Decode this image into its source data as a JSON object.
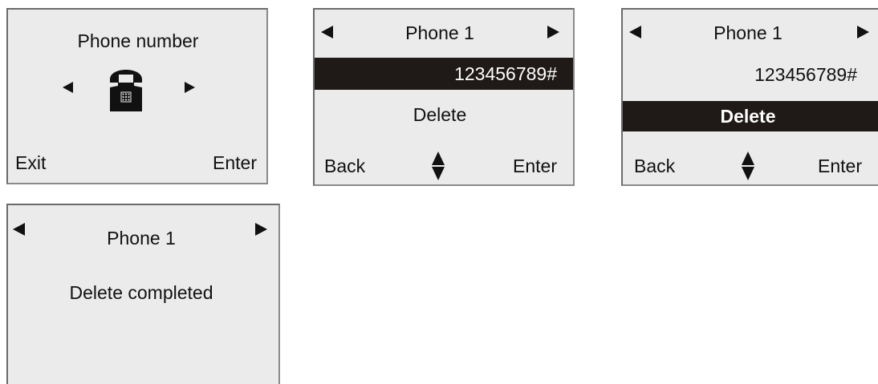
{
  "screens": [
    {
      "title": "Phone number",
      "icon": "telephone-icon",
      "left_softkey": "Exit",
      "right_softkey": "Enter"
    },
    {
      "title": "Phone  1",
      "number": "123456789#",
      "option": "Delete",
      "selected": "number",
      "left_softkey": "Back",
      "right_softkey": "Enter"
    },
    {
      "title": "Phone  1",
      "number": "123456789#",
      "option": "Delete",
      "selected": "option",
      "left_softkey": "Back",
      "right_softkey": "Enter"
    },
    {
      "title": "Phone  1",
      "message": "Delete  completed"
    }
  ],
  "colors": {
    "screen_background": "#ebebeb",
    "selection_bar": "#1f1a17",
    "selected_text": "#ffffff",
    "text": "#111111"
  }
}
